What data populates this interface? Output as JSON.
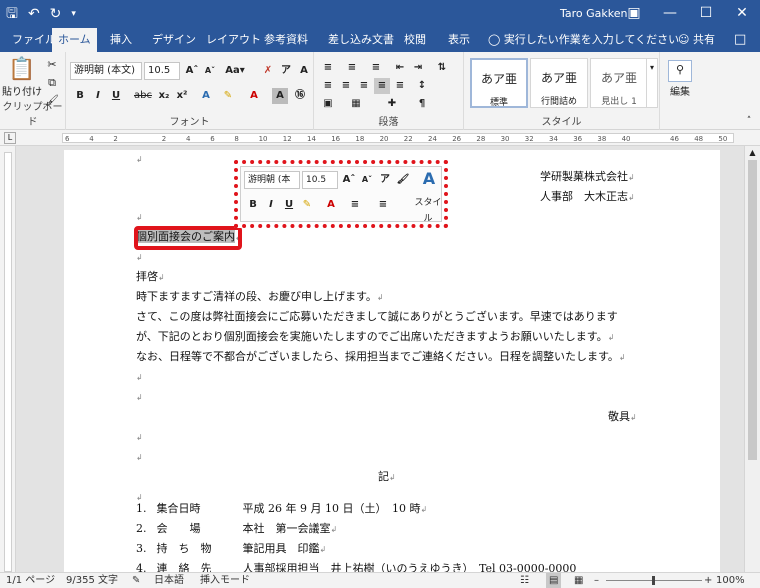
{
  "titlebar": {
    "user": "Taro Gakken",
    "qat": [
      "save-icon",
      "undo-icon",
      "redo-icon",
      "customize-icon"
    ],
    "controls": [
      "minimize-icon",
      "maximize-icon",
      "close-icon"
    ]
  },
  "tabs": [
    {
      "label": "ファイル"
    },
    {
      "label": "ホーム"
    },
    {
      "label": "挿入"
    },
    {
      "label": "デザイン"
    },
    {
      "label": "レイアウト"
    },
    {
      "label": "参考資料"
    },
    {
      "label": "差し込み文書"
    },
    {
      "label": "校閲"
    },
    {
      "label": "表示"
    }
  ],
  "tell_me": "実行したい作業を入力してください",
  "share": "共有",
  "ribbon": {
    "clipboard": {
      "paste": "貼り付け",
      "label": "クリップボード"
    },
    "font": {
      "name": "游明朝 (本文)",
      "size": "10.5",
      "label": "フォント",
      "buttons": [
        "B",
        "I",
        "U",
        "abc",
        "x₂",
        "x²"
      ]
    },
    "paragraph": {
      "label": "段落"
    },
    "styles": {
      "label": "スタイル",
      "items": [
        {
          "sample": "あア亜",
          "name": "標準"
        },
        {
          "sample": "あア亜",
          "name": "行間詰め"
        },
        {
          "sample": "あア亜",
          "name": "見出し 1"
        }
      ]
    },
    "editing": {
      "label": "編集"
    }
  },
  "ruler": {
    "numbers": [
      "6",
      "4",
      "2",
      "",
      "2",
      "4",
      "6",
      "8",
      "10",
      "12",
      "14",
      "16",
      "18",
      "20",
      "22",
      "24",
      "26",
      "28",
      "30",
      "32",
      "34",
      "36",
      "38",
      "40",
      "",
      "46",
      "48",
      "50"
    ]
  },
  "minitoolbar": {
    "font": "游明朝 (本",
    "size": "10.5",
    "styles": "スタイル"
  },
  "document": {
    "company": "学研製菓株式会社",
    "dept": "人事部　大木正志",
    "title": "個別面接会のご案内",
    "greeting": "拝啓",
    "lines": [
      "時下ますますご清祥の段、お慶び申し上げます。",
      "さて、この度は弊社面接会にご応募いただきまして誠にありがとうございます。早速ではありますが、下記のとおり個別面接会を実施いたしますのでご出席いただきますようお願いいたします。",
      "なお、日程等で不都合がございましたら、採用担当までご連絡ください。日程を調整いたします。"
    ],
    "line2a": "さて、この度は弊社面接会にご応募いただきまして誠にありがとうございます。早速ではあります",
    "line2b": "が、下記のとおり個別面接会を実施いたしますのでご出席いただきますようお願いいたします。",
    "closing": "敬具",
    "ki": "記",
    "items": [
      {
        "num": "1.",
        "label": "集合日時",
        "value": "平成 26 年 9 月 10 日（土）　10 時"
      },
      {
        "num": "2.",
        "label": "会　　場",
        "value": "本社　第一会議室"
      },
      {
        "num": "3.",
        "label": "持　ち　物",
        "value": "筆記用具　印鑑"
      },
      {
        "num": "4.",
        "label": "連　絡　先",
        "value": "人事部採用担当　井上祐樹（いのうえゆうき）　Tel 03-0000-0000"
      }
    ]
  },
  "status": {
    "page": "1/1 ページ",
    "words": "9/355 文字",
    "lang": "日本語",
    "mode": "挿入モード",
    "zoom": "100%"
  }
}
